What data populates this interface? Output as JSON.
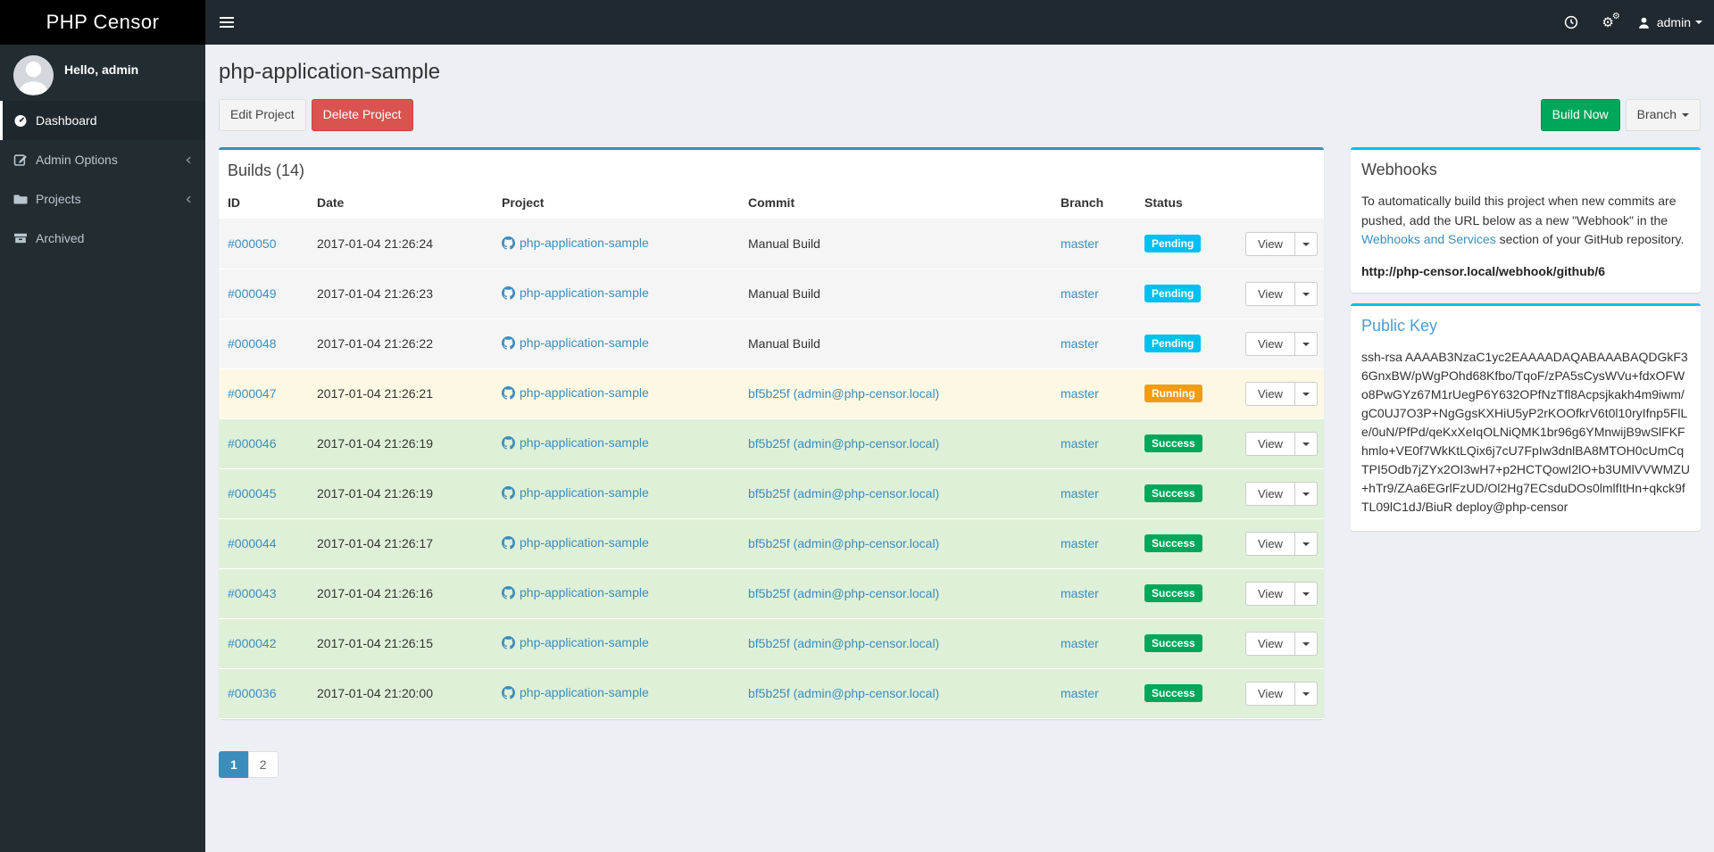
{
  "app": {
    "name": "PHP Censor"
  },
  "navbar": {
    "username": "admin"
  },
  "sidebar": {
    "greeting": "Hello, admin",
    "items": [
      {
        "label": "Dashboard",
        "active": true
      },
      {
        "label": "Admin Options",
        "chevron": true
      },
      {
        "label": "Projects",
        "chevron": true
      },
      {
        "label": "Archived"
      }
    ]
  },
  "page": {
    "title": "php-application-sample",
    "buttons": {
      "edit": "Edit Project",
      "delete": "Delete Project",
      "build_now": "Build Now",
      "branch": "Branch"
    }
  },
  "builds": {
    "title": "Builds (14)",
    "columns": [
      "ID",
      "Date",
      "Project",
      "Commit",
      "Branch",
      "Status",
      ""
    ],
    "view_label": "View",
    "status_styles": {
      "Pending": {
        "badge": "#00c0ef",
        "row": "#f5f5f5"
      },
      "Running": {
        "badge": "#f39c12",
        "row": "#fcf8e3"
      },
      "Success": {
        "badge": "#00a65a",
        "row": "#dff0d8"
      }
    },
    "rows": [
      {
        "id": "#000050",
        "date": "2017-01-04 21:26:24",
        "project": "php-application-sample",
        "commit": "Manual Build",
        "commit_link": false,
        "branch": "master",
        "status": "Pending"
      },
      {
        "id": "#000049",
        "date": "2017-01-04 21:26:23",
        "project": "php-application-sample",
        "commit": "Manual Build",
        "commit_link": false,
        "branch": "master",
        "status": "Pending"
      },
      {
        "id": "#000048",
        "date": "2017-01-04 21:26:22",
        "project": "php-application-sample",
        "commit": "Manual Build",
        "commit_link": false,
        "branch": "master",
        "status": "Pending"
      },
      {
        "id": "#000047",
        "date": "2017-01-04 21:26:21",
        "project": "php-application-sample",
        "commit": "bf5b25f (admin@php-censor.local)",
        "commit_link": true,
        "branch": "master",
        "status": "Running"
      },
      {
        "id": "#000046",
        "date": "2017-01-04 21:26:19",
        "project": "php-application-sample",
        "commit": "bf5b25f (admin@php-censor.local)",
        "commit_link": true,
        "branch": "master",
        "status": "Success"
      },
      {
        "id": "#000045",
        "date": "2017-01-04 21:26:19",
        "project": "php-application-sample",
        "commit": "bf5b25f (admin@php-censor.local)",
        "commit_link": true,
        "branch": "master",
        "status": "Success"
      },
      {
        "id": "#000044",
        "date": "2017-01-04 21:26:17",
        "project": "php-application-sample",
        "commit": "bf5b25f (admin@php-censor.local)",
        "commit_link": true,
        "branch": "master",
        "status": "Success"
      },
      {
        "id": "#000043",
        "date": "2017-01-04 21:26:16",
        "project": "php-application-sample",
        "commit": "bf5b25f (admin@php-censor.local)",
        "commit_link": true,
        "branch": "master",
        "status": "Success"
      },
      {
        "id": "#000042",
        "date": "2017-01-04 21:26:15",
        "project": "php-application-sample",
        "commit": "bf5b25f (admin@php-censor.local)",
        "commit_link": true,
        "branch": "master",
        "status": "Success"
      },
      {
        "id": "#000036",
        "date": "2017-01-04 21:20:00",
        "project": "php-application-sample",
        "commit": "bf5b25f (admin@php-censor.local)",
        "commit_link": true,
        "branch": "master",
        "status": "Success"
      }
    ]
  },
  "pagination": {
    "pages": [
      {
        "label": "1",
        "active": true
      },
      {
        "label": "2",
        "active": false
      }
    ]
  },
  "webhooks": {
    "title": "Webhooks",
    "text_before": "To automatically build this project when new commits are pushed, add the URL below as a new \"Webhook\" in the ",
    "link_text": "Webhooks and Services",
    "text_after": " section of your GitHub repository.",
    "url": "http://php-censor.local/webhook/github/6"
  },
  "public_key": {
    "title": "Public Key",
    "key": "ssh-rsa AAAAB3NzaC1yc2EAAAADAQABAAABAQDGkF36GnxBW/pWgPOhd68Kfbo/TqoF/zPA5sCysWVu+fdxOFWo8PwGYz67M1rUegP6Y632OPfNzTfl8Acpsjkakh4m9iwm/gC0UJ7O3P+NgGgsKXHiU5yP2rKOOfkrV6t0l10ryIfnp5FlLe/0uN/PfPd/qeKxXeIqOLNiQMK1br96g6YMnwijB9wSlFKFhmlo+VE0f7WkKtLQix6j7cU7FpIw3dnlBA8MTOH0cUmCqTPI5Odb7jZYx2OI3wH7+p2HCTQowI2lO+b3UMlVVWMZU+hTr9/ZAa6EGrlFzUD/Ol2Hg7ECsduDOs0lmlfItHn+qkck9fTL09lC1dJ/BiuR deploy@php-censor"
  },
  "colors": {
    "accent": "#3c8dbc",
    "info": "#00c0ef",
    "success": "#00a65a",
    "warning": "#f39c12",
    "danger": "#d9534f",
    "sidebar": "#222d32",
    "body_bg": "#ecf0f5"
  }
}
